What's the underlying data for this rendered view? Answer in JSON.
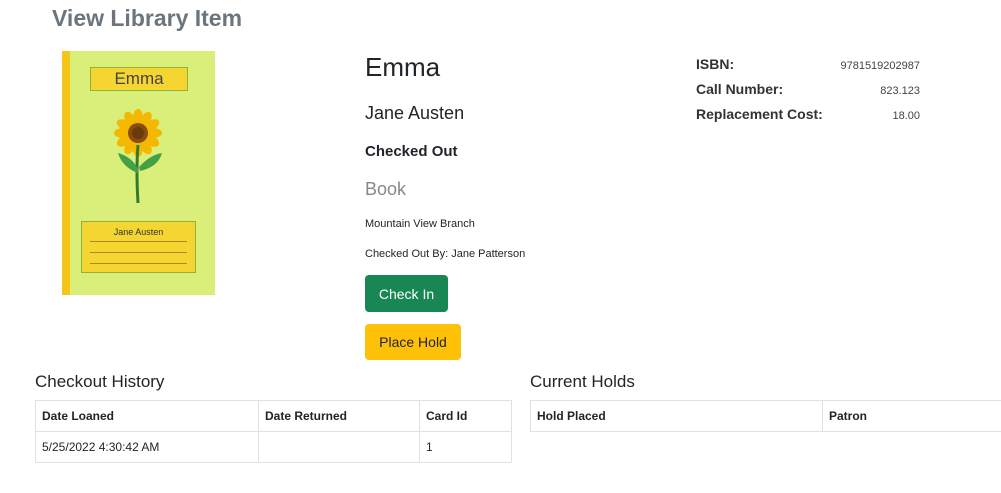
{
  "page": {
    "title": "View Library Item"
  },
  "cover": {
    "title": "Emma",
    "author": "Jane Austen"
  },
  "item": {
    "title": "Emma",
    "author": "Jane Austen",
    "status": "Checked Out",
    "type": "Book",
    "branch": "Mountain View Branch",
    "checked_out_by": "Checked Out By: Jane Patterson"
  },
  "actions": {
    "check_in": "Check In",
    "place_hold": "Place Hold"
  },
  "meta": [
    {
      "label": "ISBN:",
      "value": "9781519202987"
    },
    {
      "label": "Call Number:",
      "value": "823.123"
    },
    {
      "label": "Replacement Cost:",
      "value": "18.00"
    }
  ],
  "history": {
    "title": "Checkout History",
    "columns": [
      "Date Loaned",
      "Date Returned",
      "Card Id"
    ],
    "rows": [
      [
        "5/25/2022 4:30:42 AM",
        "",
        "1"
      ]
    ]
  },
  "holds": {
    "title": "Current Holds",
    "columns": [
      "Hold Placed",
      "Patron"
    ],
    "rows": []
  },
  "colors": {
    "primary_green": "#198754",
    "warning_yellow": "#ffc107",
    "cover_bg": "#d9ef7a"
  },
  "icons": {
    "cover_illustration": "sunflower-icon"
  }
}
